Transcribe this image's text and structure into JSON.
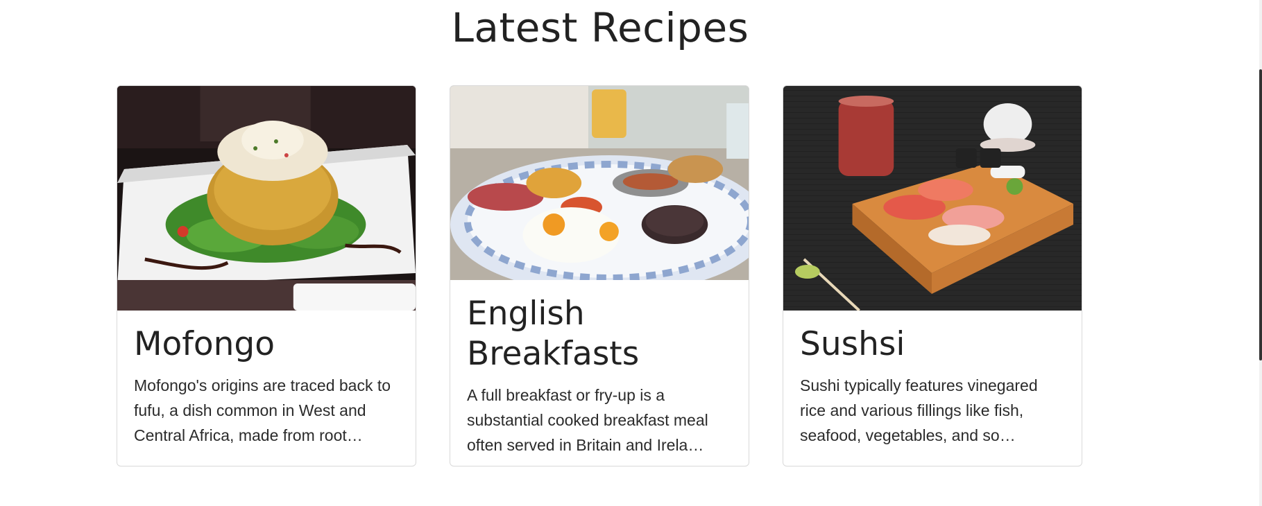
{
  "section": {
    "title": "Latest Recipes"
  },
  "recipes": [
    {
      "title": "Mofongo",
      "description": "Mofongo's origins are traced back to fufu, a dish common in West and Central Africa, made from root…",
      "image_alt": "Mofongo"
    },
    {
      "title": "English Breakfasts",
      "description": "A full breakfast or fry-up is a substantial cooked breakfast meal often served in Britain and Irela…",
      "image_alt": "English Breakfasts"
    },
    {
      "title": "Sushsi",
      "description": "Sushi typically features vinegared rice and various fillings like fish, seafood, vegetables, and so…",
      "image_alt": "Sushsi"
    }
  ],
  "colors": {
    "text": "#222222",
    "card_border": "#d9d9d9",
    "background": "#ffffff"
  }
}
